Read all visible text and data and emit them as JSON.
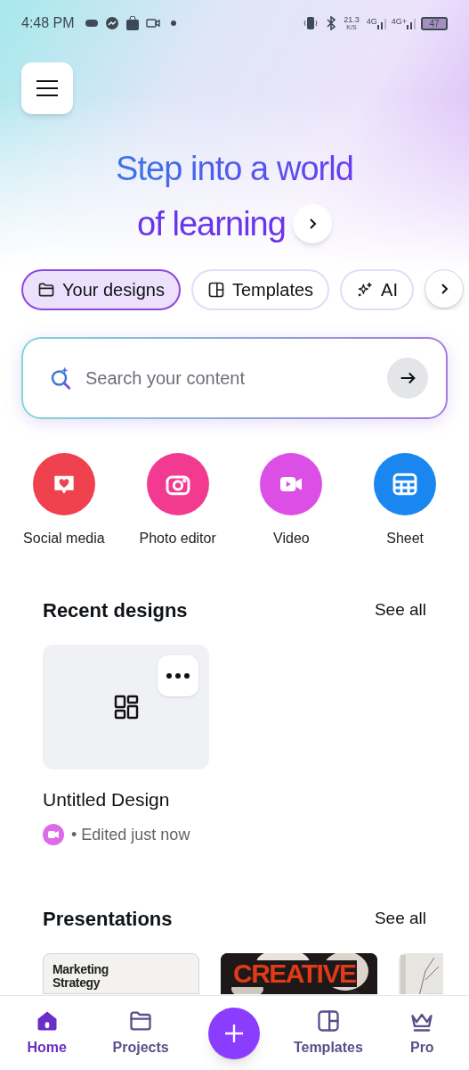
{
  "status_bar": {
    "time": "4:48 PM",
    "speed": "21.3",
    "speed_unit": "K/S",
    "network_1": "4G",
    "network_2": "4G+",
    "battery": "47"
  },
  "headline": {
    "line_1": "Step into a world",
    "line_2": "of learning"
  },
  "chips": [
    {
      "label": "Your designs",
      "selected": true
    },
    {
      "label": "Templates",
      "selected": false
    },
    {
      "label": "AI",
      "selected": false
    }
  ],
  "search": {
    "placeholder": "Search your content"
  },
  "shortcuts": [
    {
      "label": "Social media",
      "color": "#f0414e"
    },
    {
      "label": "Photo editor",
      "color": "#f23b90"
    },
    {
      "label": "Video",
      "color": "#dc4fe6"
    },
    {
      "label": "Sheet",
      "color": "#1a86ef"
    }
  ],
  "recent": {
    "title": "Recent designs",
    "see_all": "See all",
    "designs": [
      {
        "name": "Untitled Design",
        "meta": "• Edited just now"
      }
    ]
  },
  "presentations": {
    "title": "Presentations",
    "see_all": "See all",
    "items": [
      {
        "kind": "doc",
        "lines": [
          "Marketing",
          "Strategy"
        ]
      },
      {
        "kind": "poster",
        "lines": [
          "CREATIVE"
        ]
      },
      {
        "kind": "picture"
      }
    ]
  },
  "nav": [
    {
      "label": "Home",
      "selected": true
    },
    {
      "label": "Projects",
      "selected": false
    },
    {
      "kind": "create"
    },
    {
      "label": "Templates",
      "selected": false
    },
    {
      "label": "Pro",
      "selected": false
    }
  ]
}
